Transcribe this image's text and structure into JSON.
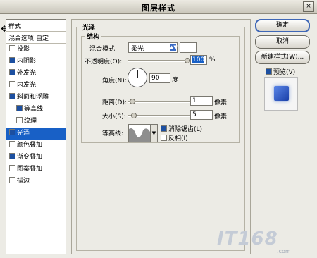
{
  "window": {
    "title": "图层样式",
    "close": "×"
  },
  "sidebar": {
    "header": "样式",
    "blend_options": "混合选项:自定",
    "items": [
      {
        "label": "投影",
        "checked": false,
        "indent": false,
        "selected": false
      },
      {
        "label": "内阴影",
        "checked": true,
        "indent": false,
        "selected": false
      },
      {
        "label": "外发光",
        "checked": true,
        "indent": false,
        "selected": false
      },
      {
        "label": "内发光",
        "checked": false,
        "indent": false,
        "selected": false
      },
      {
        "label": "斜面和浮雕",
        "checked": true,
        "indent": false,
        "selected": false
      },
      {
        "label": "等高线",
        "checked": true,
        "indent": true,
        "selected": false
      },
      {
        "label": "纹理",
        "checked": false,
        "indent": true,
        "selected": false
      },
      {
        "label": "光泽",
        "checked": true,
        "indent": false,
        "selected": true
      },
      {
        "label": "颜色叠加",
        "checked": false,
        "indent": false,
        "selected": false
      },
      {
        "label": "渐变叠加",
        "checked": true,
        "indent": false,
        "selected": false
      },
      {
        "label": "图案叠加",
        "checked": false,
        "indent": false,
        "selected": false
      },
      {
        "label": "描边",
        "checked": false,
        "indent": false,
        "selected": false
      }
    ]
  },
  "panel": {
    "group_title": "光泽",
    "structure_title": "结构",
    "blend_mode_label": "混合模式:",
    "blend_mode_value": "柔光",
    "opacity_label": "不透明度(O):",
    "opacity_value": "100",
    "opacity_unit": "%",
    "angle_label": "角度(N):",
    "angle_value": "90",
    "angle_unit": "度",
    "distance_label": "距离(D):",
    "distance_value": "1",
    "distance_unit": "像素",
    "size_label": "大小(S):",
    "size_value": "5",
    "size_unit": "像素",
    "contour_label": "等高线:",
    "antialias_label": "消除锯齿(L)",
    "antialias_checked": true,
    "invert_label": "反相(I)",
    "invert_checked": false,
    "opacity_level": 1.0,
    "distance_level": 0.02,
    "size_level": 0.05
  },
  "buttons": {
    "ok": "确定",
    "cancel": "取消",
    "new_style": "新建样式(W)...",
    "preview_label": "预览(V)",
    "preview_checked": true
  },
  "watermark": {
    "text": "IT168",
    "url": ".com"
  }
}
